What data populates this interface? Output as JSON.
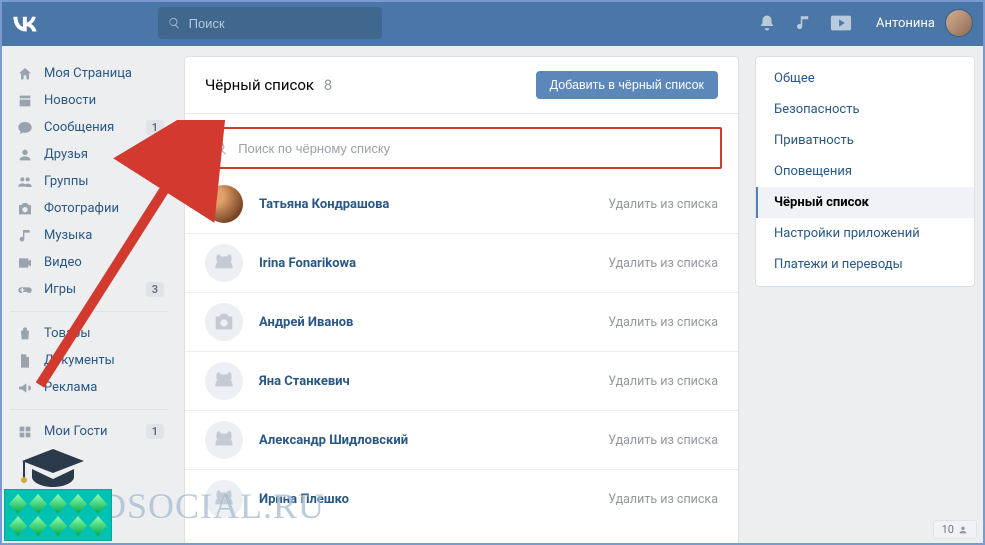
{
  "header": {
    "search_placeholder": "Поиск",
    "user_name": "Антонина"
  },
  "left_nav": {
    "items": [
      {
        "key": "my-page",
        "label": "Моя Страница"
      },
      {
        "key": "news",
        "label": "Новости"
      },
      {
        "key": "messages",
        "label": "Сообщения",
        "badge": "1"
      },
      {
        "key": "friends",
        "label": "Друзья"
      },
      {
        "key": "groups",
        "label": "Группы"
      },
      {
        "key": "photos",
        "label": "Фотографии"
      },
      {
        "key": "music",
        "label": "Музыка"
      },
      {
        "key": "videos",
        "label": "Видео"
      },
      {
        "key": "games",
        "label": "Игры",
        "badge": "3"
      }
    ],
    "items2": [
      {
        "key": "goods",
        "label": "Товары"
      },
      {
        "key": "documents",
        "label": "Документы"
      },
      {
        "key": "ads",
        "label": "Реклама"
      }
    ],
    "items3": [
      {
        "key": "guests",
        "label": "Мои Гости",
        "badge": "1"
      }
    ]
  },
  "main": {
    "title": "Чёрный список",
    "count": "8",
    "add_button_label": "Добавить в чёрный список",
    "search_placeholder": "Поиск по чёрному списку",
    "remove_label": "Удалить из списка",
    "users": [
      {
        "name": "Татьяна Кондрашова",
        "avatar": "photo1"
      },
      {
        "name": "Irina Fonarikowa",
        "avatar": "dog"
      },
      {
        "name": "Андрей Иванов",
        "avatar": "camera"
      },
      {
        "name": "Яна Станкевич",
        "avatar": "dog"
      },
      {
        "name": "Александр Шидловский",
        "avatar": "dog"
      },
      {
        "name": "Ирина Плешко",
        "avatar": "dog"
      }
    ]
  },
  "right_nav": {
    "items": [
      {
        "label": "Общее"
      },
      {
        "label": "Безопасность"
      },
      {
        "label": "Приватность"
      },
      {
        "label": "Оповещения"
      },
      {
        "label": "Чёрный список",
        "active": true
      },
      {
        "label": "Настройки приложений"
      },
      {
        "label": "Платежи и переводы"
      }
    ]
  },
  "watermark": "GIDSOCIAL.RU",
  "notification_count": "10"
}
